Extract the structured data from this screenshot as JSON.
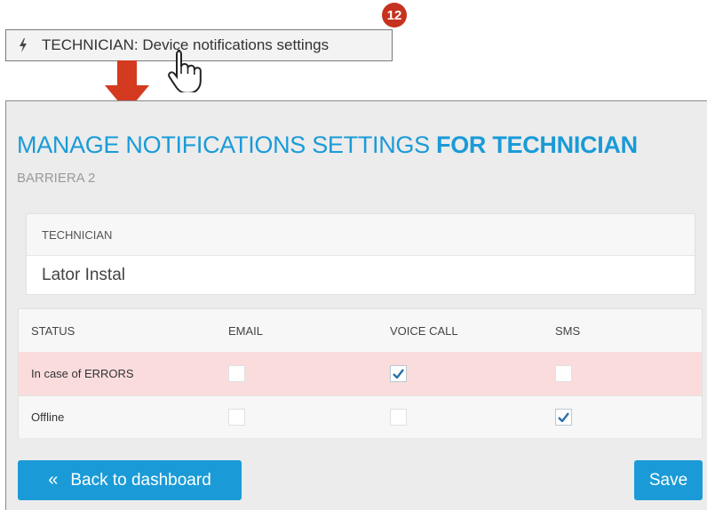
{
  "callout": {
    "label": "TECHNICIAN: Device notifications settings",
    "badge": "12",
    "icon": "bolt-icon"
  },
  "panel": {
    "title_normal": "MANAGE NOTIFICATIONS SETTINGS ",
    "title_bold": "FOR TECHNICIAN",
    "subtitle": "BARRIERA 2",
    "technician_header": "TECHNICIAN",
    "technician_name": "Lator Instal"
  },
  "table": {
    "headers": [
      "STATUS",
      "EMAIL",
      "VOICE CALL",
      "SMS"
    ],
    "rows": [
      {
        "status": "In case of ERRORS",
        "email": false,
        "voice": true,
        "sms": false
      },
      {
        "status": "Offline",
        "email": false,
        "voice": false,
        "sms": true
      }
    ]
  },
  "buttons": {
    "back": "Back to dashboard",
    "back_glyph": "«",
    "save": "Save"
  },
  "colors": {
    "accent": "#1a9bd7",
    "error_row": "#fadcdc",
    "badge": "#c6321f",
    "arrow": "#d43a1f"
  }
}
